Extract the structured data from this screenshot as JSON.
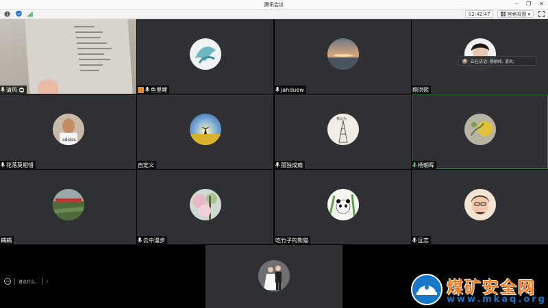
{
  "window": {
    "title": "腾讯会议"
  },
  "toolbar": {
    "timer": "02:42:47",
    "view_label": "宫格视图"
  },
  "speaking": {
    "text": "正在讲话: 杨朝晖; 清风;"
  },
  "tiles": [
    {
      "name": "清风"
    },
    {
      "name": "鱼里鲤"
    },
    {
      "name": "jahduew"
    },
    {
      "name": "翔洪熙"
    },
    {
      "name": "花落莫相惜"
    },
    {
      "name": "自定义"
    },
    {
      "name": "孤独成瘾"
    },
    {
      "name": "杨朝晖"
    },
    {
      "name": "耦耦"
    },
    {
      "name": "云中漫步"
    },
    {
      "name": "吃竹子的熊猫"
    },
    {
      "name": "远志"
    }
  ],
  "avatar_texts": {
    "eiffel_caption": "我以为"
  },
  "chat": {
    "placeholder": "说点什么..."
  },
  "watermark": {
    "title": "煤矿安全网",
    "url": "www.mkaq.org"
  },
  "colors": {
    "tile_bg": "#2e3033",
    "active_border": "#3e7a46",
    "watermark_orange": "#f47b1e",
    "watermark_blue": "#1777c9"
  }
}
